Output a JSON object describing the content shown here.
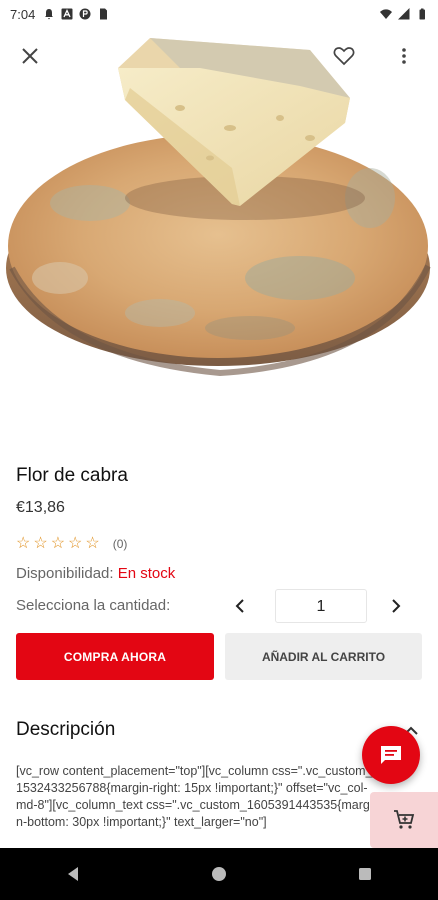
{
  "status_bar": {
    "time": "7:04",
    "left_icons": [
      "notification-bell-icon",
      "app-a-icon",
      "app-p-icon",
      "sim-card-icon"
    ],
    "right_icons": [
      "wifi-icon",
      "signal-icon",
      "battery-icon"
    ]
  },
  "top_bar": {
    "icons": [
      "close-icon",
      "heart-icon",
      "more-vert-icon"
    ]
  },
  "product": {
    "title": "Flor de cabra",
    "price": "€13,86",
    "rating_count": "(0)",
    "rating_stars": 0,
    "availability_label": "Disponibilidad:",
    "availability_value": "En stock",
    "quantity_label": "Selecciona la cantidad:",
    "quantity_value": "1"
  },
  "actions": {
    "buy_now": "COMPRA AHORA",
    "add_to_cart": "AÑADIR AL CARRITO"
  },
  "description": {
    "title": "Descripción",
    "text": "[vc_row content_placement=\"top\"][vc_column css=\".vc_custom_1532433256788{margin-right: 15px !important;}\" offset=\"vc_col-md-8\"][vc_column_text css=\".vc_custom_1605391443535{margin-bottom: 30px !important;}\" text_larger=\"no\"]"
  },
  "colors": {
    "accent": "#e30613",
    "star": "#e0901e",
    "cart_float_bg": "#f7d4d6"
  }
}
